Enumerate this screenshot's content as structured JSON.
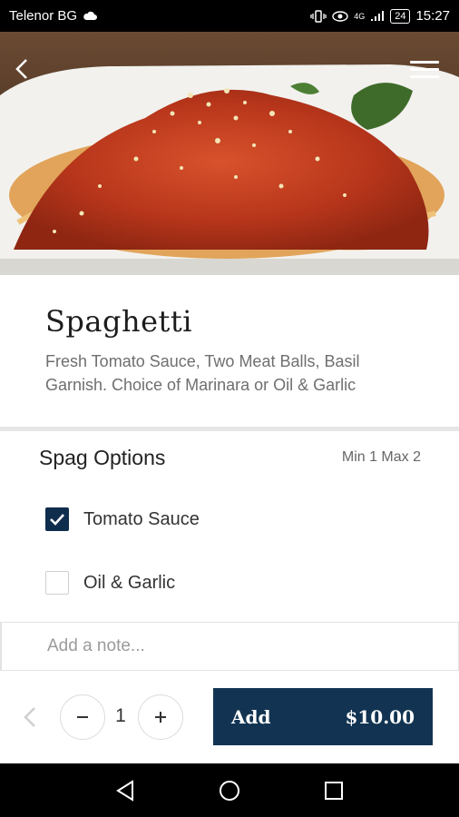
{
  "status": {
    "carrier": "Telenor BG",
    "battery": "24",
    "time": "15:27",
    "signal": "4G"
  },
  "item": {
    "title": "Spaghetti",
    "description": "Fresh Tomato Sauce, Two Meat Balls, Basil Garnish. Choice of Marinara or Oil & Garlic"
  },
  "options": {
    "title": "Spag Options",
    "limit": "Min 1 Max 2",
    "choices": [
      {
        "label": "Tomato Sauce",
        "checked": true
      },
      {
        "label": "Oil & Garlic",
        "checked": false
      }
    ]
  },
  "note": {
    "placeholder": "Add a note...",
    "value": ""
  },
  "order": {
    "quantity": "1",
    "add_label": "Add",
    "price": "$10.00"
  },
  "colors": {
    "accent": "#123452",
    "checkbox_checked": "#0f2d4d"
  },
  "icons": {
    "back": "chevron-left-icon",
    "menu": "hamburger-menu-icon",
    "minus": "minus-icon",
    "plus": "plus-icon"
  }
}
